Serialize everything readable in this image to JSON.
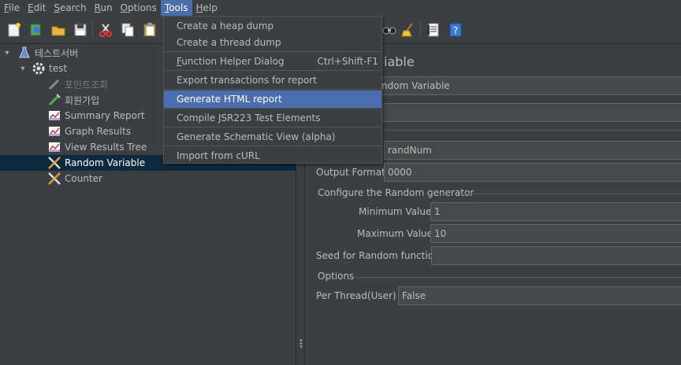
{
  "menubar": {
    "items": [
      {
        "label": "File",
        "mn": "F",
        "rest": "ile"
      },
      {
        "label": "Edit",
        "mn": "E",
        "rest": "dit"
      },
      {
        "label": "Search",
        "mn": "S",
        "rest": "earch"
      },
      {
        "label": "Run",
        "mn": "R",
        "rest": "un"
      },
      {
        "label": "Options",
        "mn": "O",
        "rest": "ptions"
      },
      {
        "label": "Tools",
        "mn": "T",
        "rest": "ools"
      },
      {
        "label": "Help",
        "mn": "H",
        "rest": "elp"
      }
    ]
  },
  "toolbar": {
    "icons": [
      "new-icon",
      "templates-icon",
      "open-icon",
      "save-icon",
      "cut-icon",
      "copy-icon",
      "paste-icon",
      "search-icon",
      "clear-all-icon",
      "function-helper-icon",
      "help-icon"
    ]
  },
  "tree": {
    "items": [
      {
        "label": "테스트서버",
        "icon": "flask-icon"
      },
      {
        "label": "test",
        "icon": "gear-icon"
      },
      {
        "label": "포인트조회",
        "icon": "pipette-icon",
        "disabled": true
      },
      {
        "label": "회원가입",
        "icon": "pipette-icon"
      },
      {
        "label": "Summary Report",
        "icon": "chart-icon"
      },
      {
        "label": "Graph Results",
        "icon": "chart-icon"
      },
      {
        "label": "View Results Tree",
        "icon": "chart-icon"
      },
      {
        "label": "Random Variable",
        "icon": "tools-icon",
        "selected": true
      },
      {
        "label": "Counter",
        "icon": "tools-icon"
      }
    ]
  },
  "tools_menu": {
    "items": [
      {
        "label": "Create a heap dump"
      },
      {
        "label": "Create a thread dump"
      },
      {
        "label": "Function Helper Dialog",
        "mn": "F",
        "rest": "unction Helper Dialog",
        "accel": "Ctrl+Shift-F1"
      },
      {
        "label": "Export transactions for report"
      },
      {
        "label": "Generate HTML report"
      },
      {
        "label": "Compile JSR223 Test Elements"
      },
      {
        "label": "Generate Schematic View (alpha)"
      },
      {
        "label": "Import from cURL"
      }
    ]
  },
  "panel": {
    "title_visible": "iable",
    "name_visible": "ndom Variable",
    "variable_name": "randNum",
    "output_format_label": "Output Format:",
    "output_format": "0000",
    "random_group_label": "Configure the Random generator",
    "min_label": "Minimum Value:",
    "min_value": "1",
    "max_label": "Maximum Value:",
    "max_value": "10",
    "seed_label": "Seed for Random function:",
    "seed_value": "",
    "options_group_label": "Options",
    "per_thread_label": "Per Thread(User) ?:",
    "per_thread_value": "False"
  },
  "colors": {
    "background": "#3c3f41",
    "selection": "#4b6eaf",
    "tree_selection": "#0d293e",
    "text": "#bbbbbb"
  }
}
